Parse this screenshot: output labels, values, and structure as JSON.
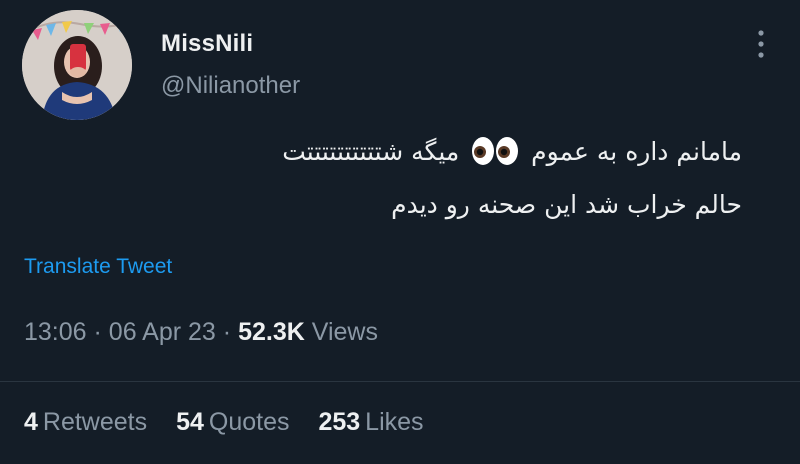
{
  "author": {
    "display_name": "MissNili",
    "handle": "@Nilianother"
  },
  "tweet": {
    "line1": "مامانم داره به عموم",
    "line1_emoji": "eyes-emoji",
    "line1_after": "میگه شتتتتتتتتتتت",
    "line2": "حالم خراب شد این صحنه رو دیدم"
  },
  "translate_label": "Translate Tweet",
  "meta": {
    "time": "13:06",
    "separator": "·",
    "date": "06 Apr 23",
    "views_count": "52.3K",
    "views_label": "Views"
  },
  "stats": {
    "retweets_count": "4",
    "retweets_label": "Retweets",
    "quotes_count": "54",
    "quotes_label": "Quotes",
    "likes_count": "253",
    "likes_label": "Likes"
  },
  "colors": {
    "background": "#141d27",
    "link": "#1d9bf0",
    "muted": "#8b98a5",
    "text": "#eef0f1"
  }
}
